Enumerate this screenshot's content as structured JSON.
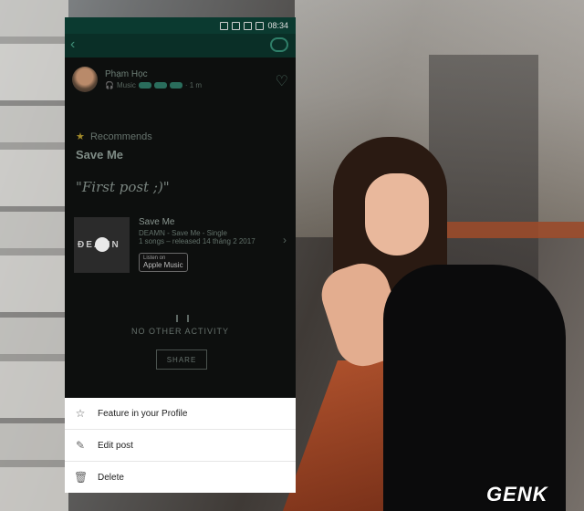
{
  "status_bar": {
    "time": "08:34"
  },
  "post": {
    "author_name": "Phạm Học",
    "author_meta": "Music",
    "author_time": "· 1 m",
    "recommends_label": "Recommends",
    "title": "Save Me",
    "quote": "\"First post ;)\""
  },
  "track": {
    "cover_text": "ĐEAMN",
    "name": "Save Me",
    "artist_line": "DEAMN - Save Me - Single",
    "release_line": "1 songs – released 14 tháng 2 2017",
    "badge_small": "Listen on",
    "badge_label": "Apple Music"
  },
  "activity": {
    "empty_label": "NO OTHER ACTIVITY",
    "share_label": "SHARE"
  },
  "sheet": {
    "items": [
      {
        "label": "Feature in your Profile",
        "icon": "star-outline-icon"
      },
      {
        "label": "Edit post",
        "icon": "pencil-icon"
      },
      {
        "label": "Delete",
        "icon": "trash-icon"
      }
    ]
  },
  "watermark": {
    "text": "GENK"
  }
}
